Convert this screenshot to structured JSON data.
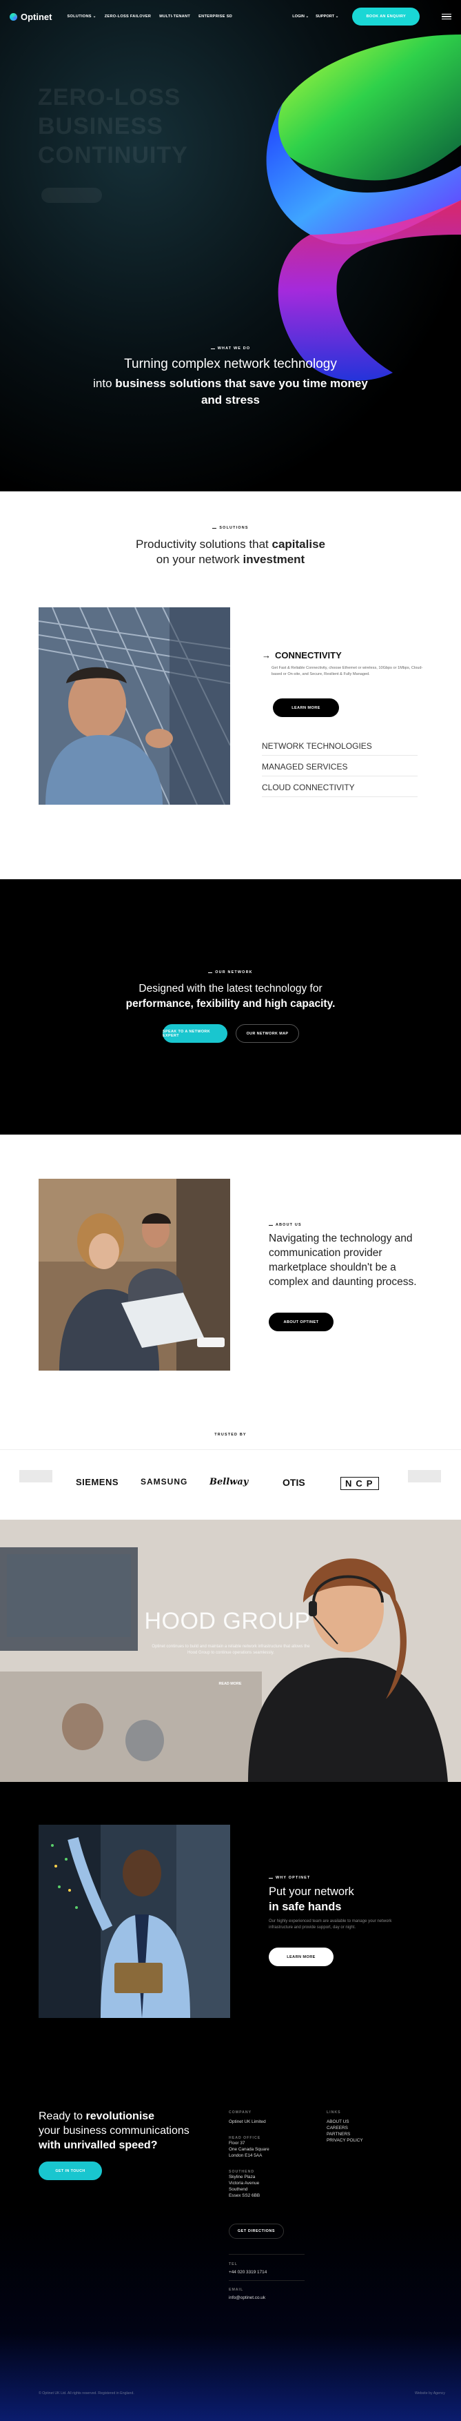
{
  "colors": {
    "accent": "#1ad7d5",
    "dark": "#000000",
    "light": "#ffffff"
  },
  "nav": {
    "logo": "Optinet",
    "items": [
      "SOLUTIONS",
      "ZERO-LOSS FAILOVER",
      "MULTI-TENANT",
      "ENTERPRISE SD"
    ],
    "login": "LOGIN",
    "support": "SUPPORT",
    "cta": "BOOK AN ENQUIRY",
    "menu_icon": "hamburger-icon"
  },
  "hero": {
    "ghost_lines": [
      "ZERO-LOSS",
      "BUSINESS",
      "CONTINUITY"
    ],
    "eyebrow": "WHAT WE DO",
    "line1": "Turning complex network technology",
    "line2_plain": "into ",
    "line2_bold": "business solutions that save you time money and stress"
  },
  "solutions": {
    "eyebrow": "SOLUTIONS",
    "title_plain1": "Productivity solutions that ",
    "title_bold1": "capitalise",
    "title_plain2": "on your network ",
    "title_bold2": "investment",
    "active": "CONNECTIVITY",
    "active_desc": "Get Fast & Reliable Connectivity, choose Ethernet or wireless, 10Gbps or 1Mbps, Cloud-based or On-site, and Secure, Resilient & Fully Managed.",
    "learn_more": "LEARN MORE",
    "list": [
      "NETWORK TECHNOLOGIES",
      "MANAGED SERVICES",
      "CLOUD CONNECTIVITY"
    ]
  },
  "technology": {
    "eyebrow": "OUR NETWORK",
    "line1": "Designed with the latest technology for",
    "line2": "performance, fexibility and high capacity.",
    "btn_primary": "SPEAK TO A NETWORK EXPERT",
    "btn_secondary": "OUR NETWORK MAP"
  },
  "about": {
    "eyebrow": "ABOUT US",
    "text": "Navigating the technology and communication provider marketplace shouldn't be a complex and daunting process.",
    "button": "ABOUT OPTINET"
  },
  "trusted": {
    "eyebrow": "TRUSTED BY",
    "brands": [
      "SIEMENS",
      "SAMSUNG",
      "Bellway",
      "OTIS",
      "NCP"
    ]
  },
  "case_study": {
    "title": "HOOD GROUP",
    "desc": "Optinet continues to build and maintain a reliable network infrastructure that allows the Hood Group to continue operations seamlessly.",
    "button": "READ MORE"
  },
  "safe_hands": {
    "eyebrow": "WHY OPTINET",
    "title_plain": "Put your network",
    "title_bold": "in safe hands",
    "desc": "Our highly experienced team are available to manage your network infrastructure and provide support, day or night.",
    "button": "LEARN MORE"
  },
  "footer": {
    "title_plain1": "Ready to ",
    "title_bold1": "revolutionise",
    "title_plain2": "your business communications",
    "title_bold2": "with unrivalled speed?",
    "cta": "GET IN TOUCH",
    "company_head": "COMPANY",
    "company_name": "Optinet UK Limited",
    "head_office_label": "HEAD OFFICE",
    "head_office": [
      "Floor 37",
      "One Canada Square",
      "London E14 5AA"
    ],
    "southend_label": "SOUTHEND",
    "southend": [
      "Skyline Plaza",
      "Victoria Avenue",
      "Southend",
      "Essex SS2 6BB"
    ],
    "directions": "GET DIRECTIONS",
    "phone_label": "TEL",
    "phone": "+44 020 3319 1714",
    "email_label": "EMAIL",
    "email": "info@optinet.co.uk",
    "links_head": "LINKS",
    "links": [
      "ABOUT US",
      "CAREERS",
      "PARTNERS",
      "PRIVACY POLICY"
    ],
    "copyright": "© Optinet UK Ltd. All rights reserved. Registered in England.",
    "credit": "Website by Agency"
  }
}
